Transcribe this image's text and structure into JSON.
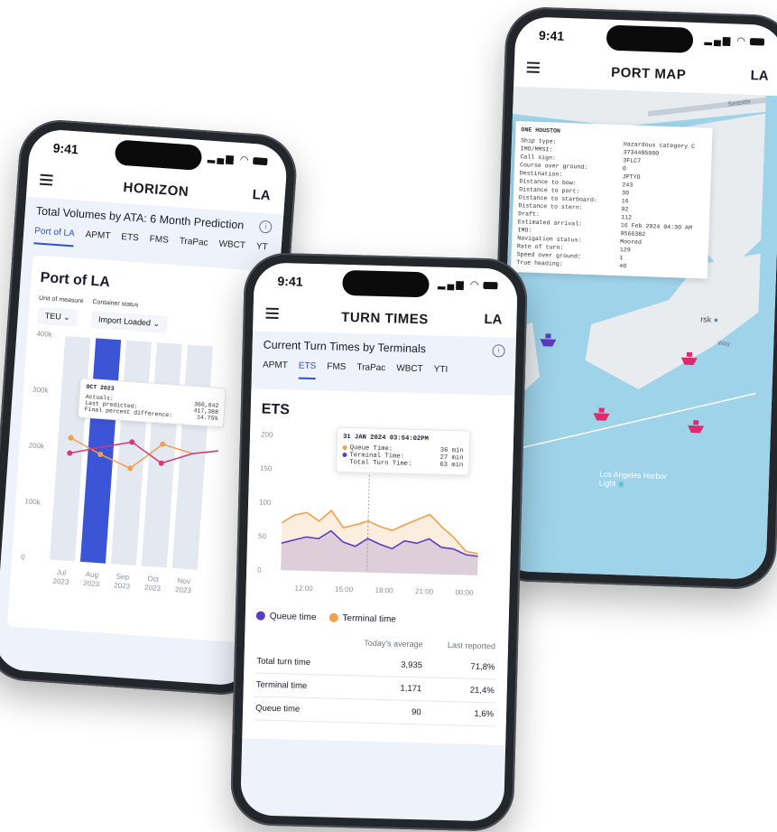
{
  "status_time": "9:41",
  "brand_logo": "LA",
  "horizon": {
    "app_title": "HORIZON",
    "section_title": "Total Volumes by ATA: 6 Month Prediction",
    "tabs": [
      "Port of LA",
      "APMT",
      "ETS",
      "FMS",
      "TraPac",
      "WBCT",
      "YT"
    ],
    "card_title": "Port of LA",
    "unit_label": "Unit of measure",
    "unit_value": "TEU",
    "status_label": "Container status",
    "status_value": "Import Loaded",
    "y_ticks": [
      "400k",
      "300k",
      "200k",
      "100k",
      "0"
    ],
    "x_labels": [
      {
        "month": "Jul",
        "year": "2023"
      },
      {
        "month": "Aug",
        "year": "2023"
      },
      {
        "month": "Sep",
        "year": "2023"
      },
      {
        "month": "Oct",
        "year": "2023"
      },
      {
        "month": "Nov",
        "year": "2023"
      }
    ],
    "tooltip": {
      "title": "OCT 2023",
      "rows": [
        {
          "label": "Actuals:",
          "value": "360,042"
        },
        {
          "label": "Last predicted:",
          "value": "417,388"
        },
        {
          "label": "Final percent difference:",
          "value": "14.75%"
        }
      ]
    }
  },
  "turn": {
    "app_title": "TURN TIMES",
    "section_title": "Current Turn Times by Terminals",
    "tabs": [
      "APMT",
      "ETS",
      "FMS",
      "TraPac",
      "WBCT",
      "YTI"
    ],
    "card_title": "ETS",
    "tooltip": {
      "title": "31 JAN 2024 03:54:02PM",
      "rows": [
        {
          "label": "Queue Time:",
          "value": "36 min"
        },
        {
          "label": "Terminal Time:",
          "value": "27 min"
        },
        {
          "label": "Total Turn Time:",
          "value": "63 min"
        }
      ]
    },
    "legend": [
      "Queue time",
      "Terminal time"
    ],
    "table": {
      "headers": [
        "",
        "Today's average",
        "Last reported"
      ],
      "rows": [
        [
          "Total turn time",
          "3,935",
          "71,8%"
        ],
        [
          "Terminal time",
          "1,171",
          "21,4%"
        ],
        [
          "Queue time",
          "90",
          "1,6%"
        ]
      ]
    }
  },
  "map": {
    "app_title": "PORT MAP",
    "vessel_name": "ONE HOUSTON",
    "rows": [
      {
        "label": "Ship type:",
        "value": "Hazardous category C"
      },
      {
        "label": "IMO/MMSI:",
        "value": "3734485000"
      },
      {
        "label": "Call sign:",
        "value": "3FLC7"
      },
      {
        "label": "Course over ground:",
        "value": "0"
      },
      {
        "label": "Destination:",
        "value": "JPTYO"
      },
      {
        "label": "Distance to bow:",
        "value": "243"
      },
      {
        "label": "Distance to port:",
        "value": "30"
      },
      {
        "label": "Distance to starboard:",
        "value": "16"
      },
      {
        "label": "Distance to stern:",
        "value": "92"
      },
      {
        "label": "Draft:",
        "value": "112"
      },
      {
        "label": "Estimated arrival:",
        "value": "16 Feb 2024 04:30 AM"
      },
      {
        "label": "IMO:",
        "value": "9566382"
      },
      {
        "label": "Navigation status:",
        "value": "Moored"
      },
      {
        "label": "Rate of turn:",
        "value": "129"
      },
      {
        "label": "Speed over ground:",
        "value": "1"
      },
      {
        "label": "True heading:",
        "value": "40"
      }
    ],
    "place_label": "Los Angeles Harbor Light",
    "place_label2": "rsk",
    "way_label": "Way",
    "road_label": "Seaside"
  },
  "chart_data": [
    {
      "type": "bar",
      "categories": [
        "Jul 2023",
        "Aug 2023",
        "Sep 2023",
        "Oct 2023",
        "Nov 2023"
      ],
      "ylim": [
        0,
        400000
      ],
      "y_ticks": [
        "400k",
        "300k",
        "200k",
        "100k",
        "0"
      ],
      "highlighted": "Aug 2023",
      "series": [
        {
          "values": [
            220000,
            180000,
            150000,
            190000,
            200000
          ]
        },
        {
          "values": [
            190000,
            210000,
            200000,
            180000,
            210000
          ]
        }
      ]
    },
    {
      "type": "area",
      "x": [
        "12:00",
        "15:00",
        "18:00",
        "21:00",
        "00:00"
      ],
      "ylim": [
        0,
        200
      ],
      "y_ticks": [
        "200",
        "150",
        "100",
        "50",
        "0"
      ],
      "series": [
        {
          "name": "Queue time",
          "color": "#5b3cc4",
          "values": [
            40,
            45,
            50,
            48,
            60,
            44,
            38,
            50,
            42,
            36,
            48,
            45,
            52,
            40,
            38,
            30,
            28
          ]
        },
        {
          "name": "Terminal time",
          "color": "#f0a04b",
          "values": [
            70,
            82,
            86,
            74,
            90,
            65,
            70,
            76,
            68,
            63,
            72,
            80,
            88,
            70,
            55,
            35,
            32
          ]
        }
      ]
    }
  ]
}
